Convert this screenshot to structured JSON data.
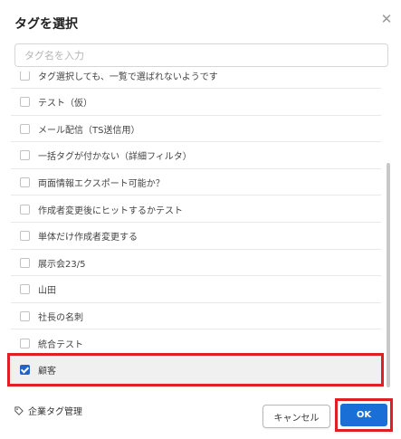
{
  "dialog": {
    "title": "タグを選択",
    "close_glyph": "✕",
    "search": {
      "placeholder": "タグ名を入力",
      "value": ""
    }
  },
  "tags": [
    {
      "label": "タグ選択しても、一覧で選ばれないようです",
      "checked": false
    },
    {
      "label": "テスト（仮）",
      "checked": false
    },
    {
      "label": "メール配信（TS送信用）",
      "checked": false
    },
    {
      "label": "一括タグが付かない（詳細フィルタ）",
      "checked": false
    },
    {
      "label": "両面情報エクスポート可能か？",
      "checked": false
    },
    {
      "label": "作成者変更後にヒットするかテスト",
      "checked": false
    },
    {
      "label": "単体だけ作成者変更する",
      "checked": false
    },
    {
      "label": "展示会23/5",
      "checked": false
    },
    {
      "label": "山田",
      "checked": false
    },
    {
      "label": "社長の名刺",
      "checked": false
    },
    {
      "label": "統合テスト",
      "checked": false
    },
    {
      "label": "顧客",
      "checked": true
    }
  ],
  "footer": {
    "manage_link": "企業タグ管理",
    "manage_icon": "tag-icon",
    "cancel_label": "キャンセル",
    "ok_label": "OK"
  },
  "colors": {
    "primary": "#1a6fd6",
    "checkbox_checked": "#1f65c8",
    "annotation_red": "#e01e26"
  }
}
